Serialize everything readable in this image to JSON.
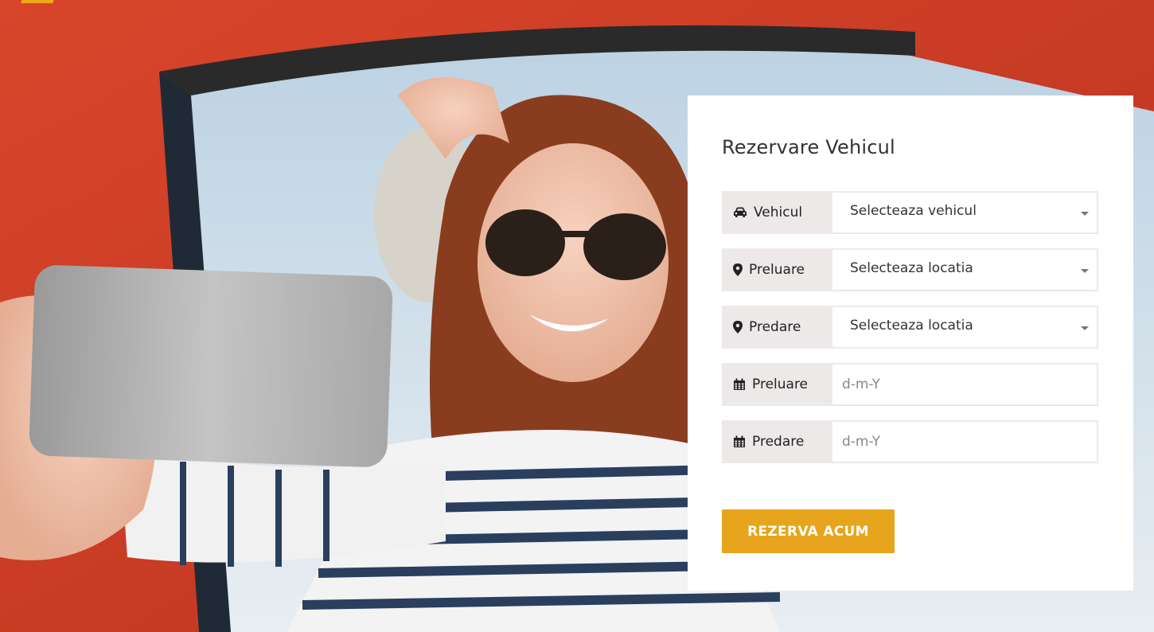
{
  "colors": {
    "accent": "#e6a51c",
    "card_bg": "#ffffff",
    "label_bg": "#ede9e9"
  },
  "booking": {
    "title": "Rezervare Vehicul",
    "rows": [
      {
        "icon": "car-icon",
        "label": "Vehicul",
        "type": "select",
        "value": "Selecteaza vehicul"
      },
      {
        "icon": "map-marker-icon",
        "label": "Preluare",
        "type": "select",
        "value": "Selecteaza locatia"
      },
      {
        "icon": "map-marker-icon",
        "label": "Predare",
        "type": "select",
        "value": "Selecteaza locatia"
      },
      {
        "icon": "calendar-icon",
        "label": "Preluare",
        "type": "date",
        "placeholder": "d-m-Y"
      },
      {
        "icon": "calendar-icon",
        "label": "Predare",
        "type": "date",
        "placeholder": "d-m-Y"
      }
    ],
    "submit_label": "REZERVA ACUM"
  }
}
